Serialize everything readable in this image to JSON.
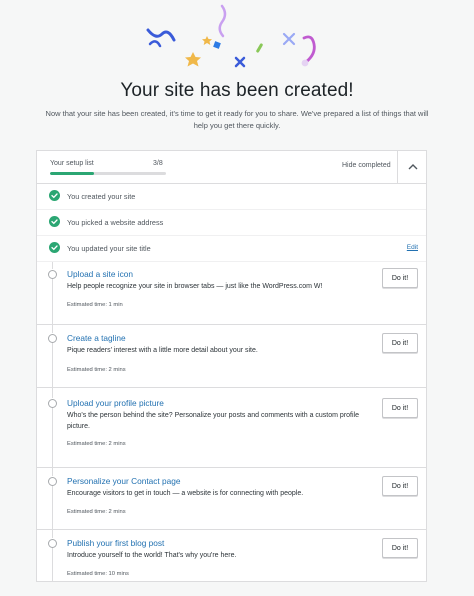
{
  "page": {
    "title": "Your site has been created!",
    "subtitle": "Now that your site has been created, it's time to get it ready for you to share. We've prepared a list of things that will help you get there quickly."
  },
  "checklist": {
    "label": "Your setup list",
    "count": "3/8",
    "progress_fraction": 0.375,
    "hide_label": "Hide completed",
    "accent_color": "#2ba673",
    "link_color": "#2271b1",
    "completed": [
      {
        "label": "You created your site"
      },
      {
        "label": "You picked a website address"
      },
      {
        "label": "You updated your site title",
        "action": "Edit"
      }
    ],
    "tasks": [
      {
        "title": "Upload a site icon",
        "description": "Help people recognize your site in browser tabs — just like the WordPress.com W!",
        "estimate": "Estimated time: 1 min",
        "button": "Do it!"
      },
      {
        "title": "Create a tagline",
        "description": "Pique readers' interest with a little more detail about your site.",
        "estimate": "Estimated time: 2 mins",
        "button": "Do it!"
      },
      {
        "title": "Upload your profile picture",
        "description": "Who's the person behind the site? Personalize your posts and comments with a custom profile picture.",
        "estimate": "Estimated time: 2 mins",
        "button": "Do it!"
      },
      {
        "title": "Personalize your Contact page",
        "description": "Encourage visitors to get in touch — a website is for connecting with people.",
        "estimate": "Estimated time: 2 mins",
        "button": "Do it!"
      },
      {
        "title": "Publish your first blog post",
        "description": "Introduce yourself to the world! That's why you're here.",
        "estimate": "Estimated time: 10 mins",
        "button": "Do it!"
      }
    ]
  }
}
